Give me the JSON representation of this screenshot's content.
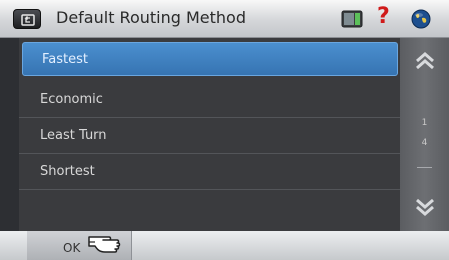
{
  "header": {
    "title": "Default Routing Method",
    "icons": [
      "back-icon",
      "sd-card-icon",
      "help-icon",
      "globe-icon"
    ],
    "help_glyph": "?"
  },
  "list": {
    "items": [
      {
        "label": "Fastest",
        "selected": true
      },
      {
        "label": "Economic",
        "selected": false
      },
      {
        "label": "Least Turn",
        "selected": false
      },
      {
        "label": "Shortest",
        "selected": false
      }
    ]
  },
  "scrollbar": {
    "current_page": "1",
    "total_pages": "4"
  },
  "footer": {
    "ok_label": "OK"
  },
  "colors": {
    "selected_item": "#3d7fc0",
    "list_background": "#3a3b3e",
    "help_icon": "#d01a1a"
  }
}
